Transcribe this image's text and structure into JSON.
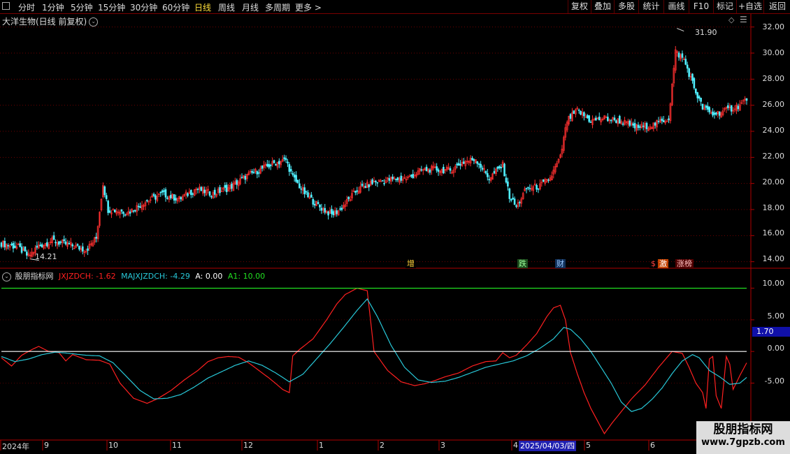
{
  "toolbar": {
    "periods": [
      "分时",
      "1分钟",
      "5分钟",
      "15分钟",
      "30分钟",
      "60分钟",
      "日线",
      "周线",
      "月线",
      "多周期",
      "更多 >"
    ],
    "active_period": "日线",
    "right_buttons": [
      "复权",
      "叠加",
      "多股",
      "统计",
      "画线",
      "F10",
      "标记",
      "+自选",
      "返回"
    ]
  },
  "stock": {
    "title": "大洋生物(日线 前复权)",
    "chevron": "⌄",
    "diamond_icon": "◇",
    "menu_icon": "☰"
  },
  "price_axis": {
    "labels": [
      "32.00",
      "30.00",
      "28.00",
      "26.00",
      "24.00",
      "22.00",
      "20.00",
      "18.00",
      "16.00",
      "14.00"
    ]
  },
  "price_annotations": {
    "high": "31.90",
    "low": "14.21"
  },
  "event_markers": [
    {
      "text": "增",
      "color": "#ffd23a",
      "bg": "#000"
    },
    {
      "text": "跌",
      "color": "#9aff9a",
      "bg": "#1d4d1d"
    },
    {
      "text": "财",
      "color": "#9ac8ff",
      "bg": "#10305a"
    },
    {
      "text": "$",
      "color": "#ff4040",
      "bg": "#000"
    },
    {
      "text": "激",
      "color": "#fff",
      "bg": "#c04000"
    },
    {
      "text": "涨榜",
      "color": "#ffc0c0",
      "bg": "#500000"
    }
  ],
  "indicator": {
    "name": "股朋指标网",
    "items": [
      {
        "text": "JXJZDCH: -1.62",
        "color": "#ff2020"
      },
      {
        "text": "MAJXJZDCH: -4.29",
        "color": "#28c8d8"
      },
      {
        "text": "A: 0.00",
        "color": "#ffffff"
      },
      {
        "text": "A1: 10.00",
        "color": "#21e021"
      }
    ],
    "axis_labels": [
      "10.00",
      "5.00",
      "0.00",
      "-5.00"
    ],
    "current_value": "1.70"
  },
  "time_axis": {
    "labels": [
      "2024年",
      "9",
      "10",
      "11",
      "12",
      "1",
      "2",
      "3",
      "4",
      "5",
      "6"
    ],
    "selected_date": "2025/04/03/四"
  },
  "watermark": {
    "name": "股朋指标网",
    "url": "www.7gpzb.com"
  },
  "chart_data": [
    {
      "type": "candlestick",
      "title": "大洋生物(日线 前复权)",
      "y_axis_ticks": [
        14,
        16,
        18,
        20,
        22,
        24,
        26,
        28,
        30,
        32
      ],
      "ylim": [
        13.5,
        33
      ],
      "close_path": [
        [
          0,
          15.4
        ],
        [
          10,
          15.1
        ],
        [
          16,
          14.4
        ],
        [
          22,
          15.2
        ],
        [
          30,
          15.6
        ],
        [
          40,
          15.3
        ],
        [
          50,
          14.9
        ],
        [
          56,
          15.8
        ],
        [
          60,
          20.0
        ],
        [
          63,
          18.0
        ],
        [
          75,
          17.8
        ],
        [
          85,
          18.6
        ],
        [
          95,
          19.2
        ],
        [
          105,
          18.8
        ],
        [
          115,
          19.6
        ],
        [
          125,
          19.2
        ],
        [
          135,
          19.7
        ],
        [
          145,
          20.6
        ],
        [
          155,
          21.2
        ],
        [
          162,
          21.6
        ],
        [
          168,
          21.8
        ],
        [
          172,
          20.5
        ],
        [
          180,
          19.1
        ],
        [
          188,
          18.2
        ],
        [
          195,
          17.6
        ],
        [
          200,
          18.0
        ],
        [
          210,
          19.5
        ],
        [
          220,
          20.1
        ],
        [
          230,
          20.3
        ],
        [
          240,
          20.4
        ],
        [
          248,
          21.0
        ],
        [
          255,
          21.1
        ],
        [
          265,
          21.0
        ],
        [
          272,
          21.6
        ],
        [
          280,
          21.9
        ],
        [
          288,
          20.4
        ],
        [
          296,
          21.4
        ],
        [
          300,
          19.0
        ],
        [
          304,
          18.2
        ],
        [
          310,
          19.6
        ],
        [
          318,
          19.8
        ],
        [
          324,
          20.4
        ],
        [
          330,
          22.0
        ],
        [
          334,
          24.8
        ],
        [
          340,
          25.6
        ],
        [
          348,
          24.8
        ],
        [
          356,
          25.0
        ],
        [
          365,
          24.8
        ],
        [
          375,
          24.3
        ],
        [
          385,
          24.5
        ],
        [
          390,
          24.8
        ],
        [
          394,
          25.0
        ],
        [
          398,
          30.1
        ],
        [
          403,
          29.5
        ],
        [
          410,
          27.0
        ],
        [
          414,
          25.8
        ],
        [
          420,
          25.3
        ],
        [
          428,
          25.6
        ],
        [
          436,
          26.0
        ],
        [
          440,
          26.5
        ]
      ],
      "annotations": [
        {
          "label": "31.90",
          "type": "high"
        },
        {
          "label": "14.21",
          "type": "low"
        }
      ]
    },
    {
      "type": "line",
      "name": "股朋指标网",
      "x_count": 441,
      "y_axis_ticks": [
        10,
        5,
        0,
        -5
      ],
      "ylim": [
        -14,
        11.5
      ],
      "series": [
        {
          "name": "JXJZDCH",
          "color": "#ff2020",
          "values_path": [
            [
              0,
              -1.0
            ],
            [
              6,
              -2.3
            ],
            [
              12,
              -0.6
            ],
            [
              18,
              0.3
            ],
            [
              22,
              0.8
            ],
            [
              28,
              0.0
            ],
            [
              34,
              -0.2
            ],
            [
              38,
              -1.5
            ],
            [
              42,
              -0.5
            ],
            [
              50,
              -1.3
            ],
            [
              58,
              -1.4
            ],
            [
              64,
              -2.0
            ],
            [
              70,
              -5.0
            ],
            [
              78,
              -7.4
            ],
            [
              86,
              -8.2
            ],
            [
              92,
              -7.5
            ],
            [
              100,
              -6.2
            ],
            [
              108,
              -4.5
            ],
            [
              116,
              -3.0
            ],
            [
              122,
              -1.6
            ],
            [
              128,
              -1.0
            ],
            [
              134,
              -0.8
            ],
            [
              140,
              -0.9
            ],
            [
              146,
              -1.8
            ],
            [
              152,
              -3.0
            ],
            [
              158,
              -4.2
            ],
            [
              163,
              -5.3
            ],
            [
              166,
              -6.0
            ],
            [
              170,
              -6.5
            ],
            [
              172,
              -0.7
            ],
            [
              176,
              0.3
            ],
            [
              184,
              2.0
            ],
            [
              192,
              5.0
            ],
            [
              198,
              7.5
            ],
            [
              203,
              9.0
            ],
            [
              210,
              10.0
            ],
            [
              216,
              9.6
            ],
            [
              220,
              0.0
            ],
            [
              228,
              -3.0
            ],
            [
              236,
              -4.8
            ],
            [
              244,
              -5.4
            ],
            [
              250,
              -5.1
            ],
            [
              256,
              -4.6
            ],
            [
              262,
              -4.0
            ],
            [
              270,
              -3.4
            ],
            [
              278,
              -2.3
            ],
            [
              286,
              -1.6
            ],
            [
              292,
              -1.5
            ],
            [
              296,
              -0.2
            ],
            [
              300,
              -1.0
            ],
            [
              304,
              -0.6
            ],
            [
              310,
              1.0
            ],
            [
              316,
              2.8
            ],
            [
              322,
              5.5
            ],
            [
              326,
              6.9
            ],
            [
              330,
              7.3
            ],
            [
              333,
              5.0
            ],
            [
              336,
              -0.2
            ],
            [
              340,
              -3.5
            ],
            [
              344,
              -6.5
            ],
            [
              348,
              -9.0
            ],
            [
              352,
              -11.0
            ],
            [
              356,
              -13.0
            ],
            [
              360,
              -11.5
            ],
            [
              366,
              -9.5
            ],
            [
              372,
              -7.5
            ],
            [
              380,
              -5.3
            ],
            [
              388,
              -2.5
            ],
            [
              396,
              0.0
            ],
            [
              402,
              -0.3
            ],
            [
              406,
              -2.5
            ],
            [
              410,
              -5.0
            ],
            [
              414,
              -6.5
            ],
            [
              416,
              -9.0
            ],
            [
              418,
              -1.2
            ],
            [
              420,
              -0.8
            ],
            [
              422,
              -7.0
            ],
            [
              425,
              -9.0
            ],
            [
              428,
              -0.8
            ],
            [
              430,
              -2.0
            ],
            [
              432,
              -6.0
            ],
            [
              436,
              -3.8
            ],
            [
              440,
              -1.8
            ]
          ]
        },
        {
          "name": "MAJXJZDCH",
          "color": "#28c8d8",
          "values_path": [
            [
              0,
              -0.8
            ],
            [
              8,
              -1.6
            ],
            [
              16,
              -1.2
            ],
            [
              24,
              -0.5
            ],
            [
              32,
              -0.1
            ],
            [
              40,
              -0.3
            ],
            [
              50,
              -0.6
            ],
            [
              58,
              -0.7
            ],
            [
              66,
              -1.8
            ],
            [
              74,
              -4.0
            ],
            [
              82,
              -6.2
            ],
            [
              90,
              -7.5
            ],
            [
              98,
              -7.4
            ],
            [
              106,
              -6.8
            ],
            [
              114,
              -5.6
            ],
            [
              122,
              -4.2
            ],
            [
              130,
              -3.2
            ],
            [
              138,
              -2.2
            ],
            [
              146,
              -1.5
            ],
            [
              154,
              -2.2
            ],
            [
              162,
              -3.4
            ],
            [
              170,
              -4.8
            ],
            [
              178,
              -3.6
            ],
            [
              186,
              -1.2
            ],
            [
              194,
              1.2
            ],
            [
              202,
              3.8
            ],
            [
              210,
              6.5
            ],
            [
              216,
              8.3
            ],
            [
              222,
              5.5
            ],
            [
              230,
              1.0
            ],
            [
              238,
              -2.5
            ],
            [
              246,
              -4.5
            ],
            [
              254,
              -4.9
            ],
            [
              262,
              -4.7
            ],
            [
              270,
              -4.1
            ],
            [
              278,
              -3.3
            ],
            [
              286,
              -2.5
            ],
            [
              294,
              -2.0
            ],
            [
              302,
              -1.5
            ],
            [
              310,
              -0.7
            ],
            [
              318,
              0.5
            ],
            [
              326,
              2.0
            ],
            [
              332,
              3.8
            ],
            [
              336,
              3.5
            ],
            [
              342,
              2.0
            ],
            [
              348,
              0.0
            ],
            [
              354,
              -2.5
            ],
            [
              360,
              -5.0
            ],
            [
              366,
              -8.0
            ],
            [
              372,
              -9.5
            ],
            [
              378,
              -9.0
            ],
            [
              384,
              -7.6
            ],
            [
              390,
              -5.8
            ],
            [
              396,
              -3.5
            ],
            [
              402,
              -1.5
            ],
            [
              408,
              -0.5
            ],
            [
              412,
              -1.0
            ],
            [
              418,
              -3.0
            ],
            [
              424,
              -4.0
            ],
            [
              430,
              -5.2
            ],
            [
              436,
              -5.0
            ],
            [
              440,
              -4.1
            ]
          ]
        },
        {
          "name": "A",
          "color": "#ffffff",
          "values_path": [
            [
              0,
              0
            ],
            [
              440,
              0
            ]
          ]
        },
        {
          "name": "A1",
          "color": "#21e021",
          "values_path": [
            [
              0,
              10
            ],
            [
              440,
              10
            ]
          ]
        }
      ]
    }
  ]
}
